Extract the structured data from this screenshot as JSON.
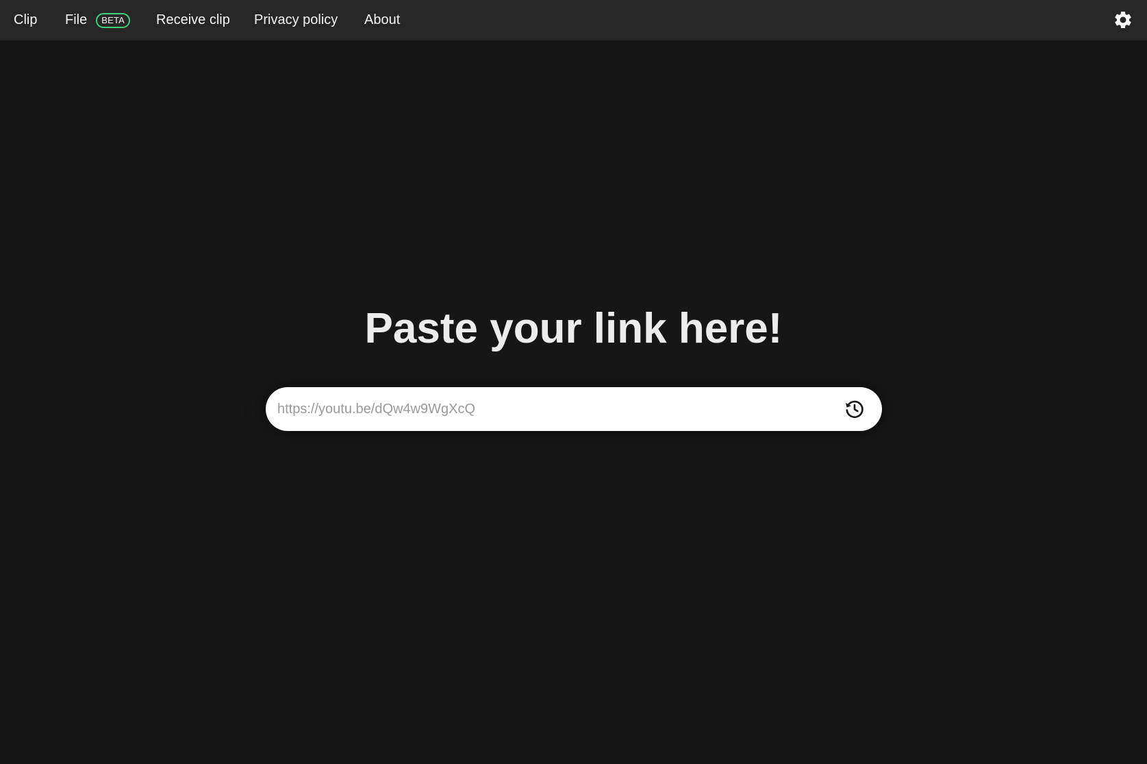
{
  "nav": {
    "items": [
      {
        "label": "Clip"
      },
      {
        "label": "File",
        "badge": "BETA"
      },
      {
        "label": "Receive clip"
      },
      {
        "label": "Privacy policy"
      },
      {
        "label": "About"
      }
    ],
    "settings_icon": "gear-icon"
  },
  "main": {
    "headline": "Paste your link here!",
    "search_placeholder": "https://youtu.be/dQw4w9WgXcQ",
    "search_value": "",
    "history_icon": "history-icon"
  },
  "colors": {
    "background": "#161616",
    "navbar": "#262626",
    "beta_border": "#3ecf7a",
    "input_background": "#ffffff"
  }
}
